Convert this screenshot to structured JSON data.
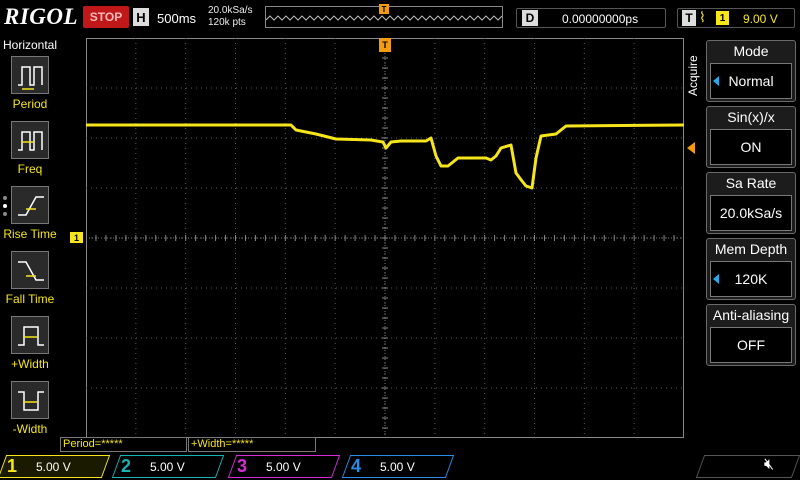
{
  "brand": "RIGOL",
  "run_state": "STOP",
  "horizontal": {
    "label": "H",
    "timebase": "500ms",
    "sample_rate": "20.0kSa/s",
    "points": "120k pts"
  },
  "delay": {
    "label": "D",
    "value": "0.00000000ps"
  },
  "trigger": {
    "label": "T",
    "channel": "1",
    "level": "9.00 V"
  },
  "left_menu": {
    "title": "Horizontal",
    "items": [
      {
        "label": "Period",
        "icon": "period-icon"
      },
      {
        "label": "Freq",
        "icon": "frequency-icon"
      },
      {
        "label": "Rise Time",
        "icon": "rise-time-icon"
      },
      {
        "label": "Fall Time",
        "icon": "fall-time-icon"
      },
      {
        "label": "+Width",
        "icon": "positive-width-icon"
      },
      {
        "label": "-Width",
        "icon": "negative-width-icon"
      }
    ]
  },
  "right_menu": {
    "section": "Acquire",
    "items": [
      {
        "label": "Mode",
        "value": "Normal"
      },
      {
        "label": "Sin(x)/x",
        "value": "ON"
      },
      {
        "label": "Sa Rate",
        "value": "20.0kSa/s"
      },
      {
        "label": "Mem Depth",
        "value": "120K"
      },
      {
        "label": "Anti-aliasing",
        "value": "OFF"
      }
    ]
  },
  "measurements": {
    "period": "Period=*****",
    "width": "+Width=*****"
  },
  "channels": [
    {
      "num": "1",
      "scale": "5.00 V",
      "color": "#f5e51a"
    },
    {
      "num": "2",
      "scale": "5.00 V",
      "color": "#17b3b3"
    },
    {
      "num": "3",
      "scale": "5.00 V",
      "color": "#d82ad8"
    },
    {
      "num": "4",
      "scale": "5.00 V",
      "color": "#2a8ae8"
    }
  ],
  "channel_marker": "1",
  "trigger_marker": "T",
  "colors": {
    "ch1": "#f5e51a",
    "stop": "#c01818",
    "grid": "#5a5a5a",
    "accent": "#2aa8e8",
    "trigger_marker": "#f39c12"
  }
}
